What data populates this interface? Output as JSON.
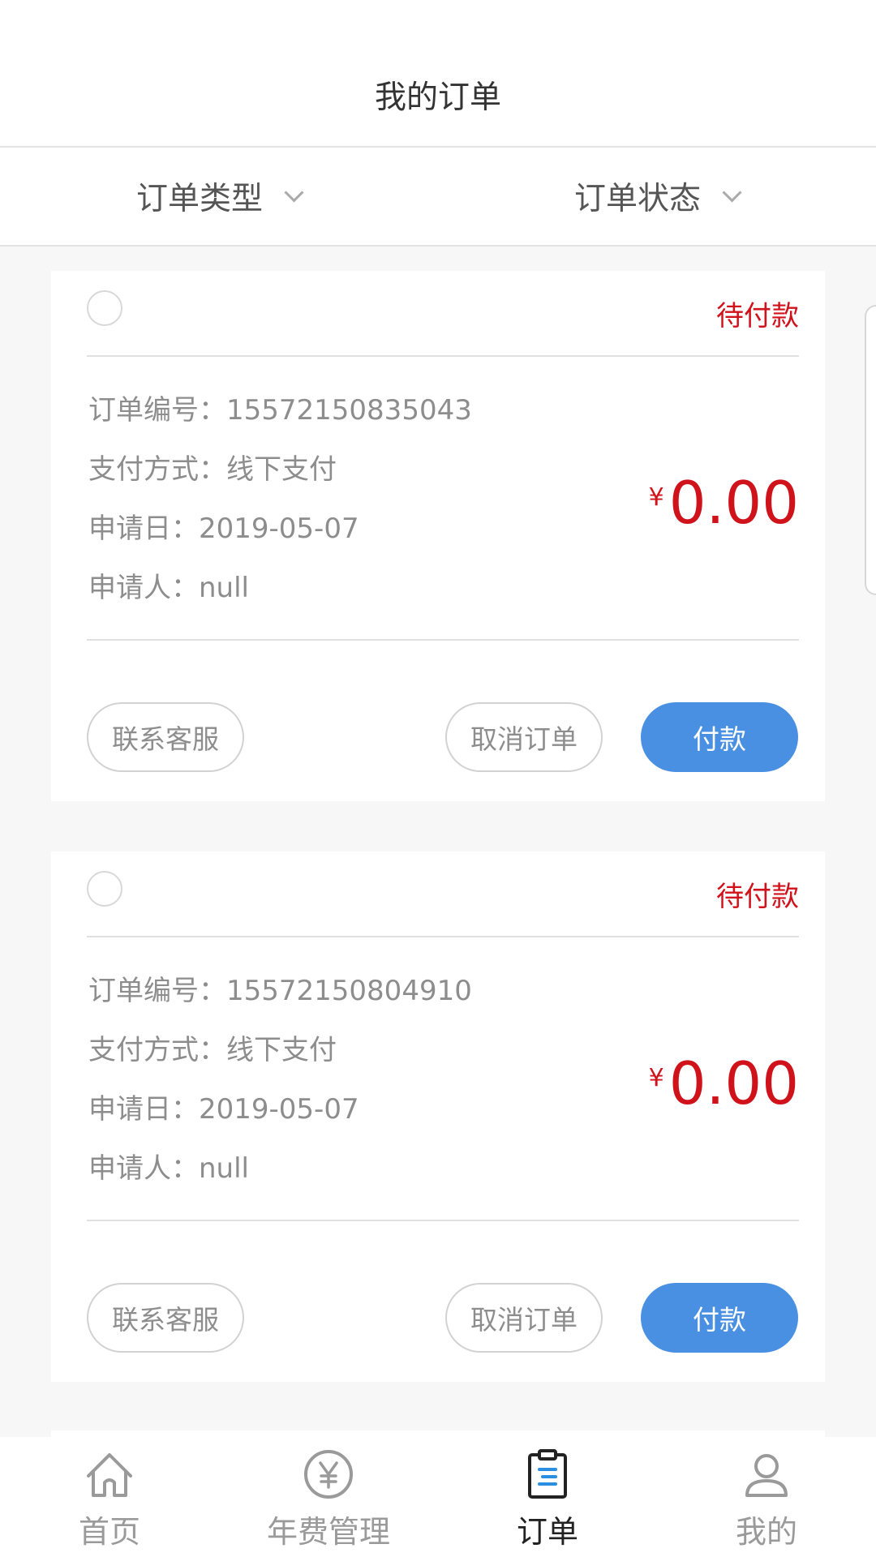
{
  "header": {
    "title": "我的订单"
  },
  "filters": {
    "type_label": "订单类型",
    "status_label": "订单状态"
  },
  "orders": [
    {
      "status": "待付款",
      "number_text": "订单编号：15572150835043",
      "payment_text": "支付方式：线下支付",
      "date_text": "申请日：2019-05-07",
      "applicant_text": "申请人：null",
      "currency": "¥",
      "amount": "0.00",
      "contact_label": "联系客服",
      "cancel_label": "取消订单",
      "pay_label": "付款"
    },
    {
      "status": "待付款",
      "number_text": "订单编号：15572150804910",
      "payment_text": "支付方式：线下支付",
      "date_text": "申请日：2019-05-07",
      "applicant_text": "申请人：null",
      "currency": "¥",
      "amount": "0.00",
      "contact_label": "联系客服",
      "cancel_label": "取消订单",
      "pay_label": "付款"
    }
  ],
  "tabbar": {
    "active": "orders",
    "items": [
      {
        "label": "首页",
        "icon": "home-icon"
      },
      {
        "label": "年费管理",
        "icon": "yen-circle-icon"
      },
      {
        "label": "订单",
        "icon": "clipboard-icon"
      },
      {
        "label": "我的",
        "icon": "user-icon"
      }
    ]
  },
  "colors": {
    "accent_blue": "#4a90e2",
    "status_red": "#d0121b",
    "text_gray": "#8d8d8d",
    "background": "#f7f7f7"
  }
}
